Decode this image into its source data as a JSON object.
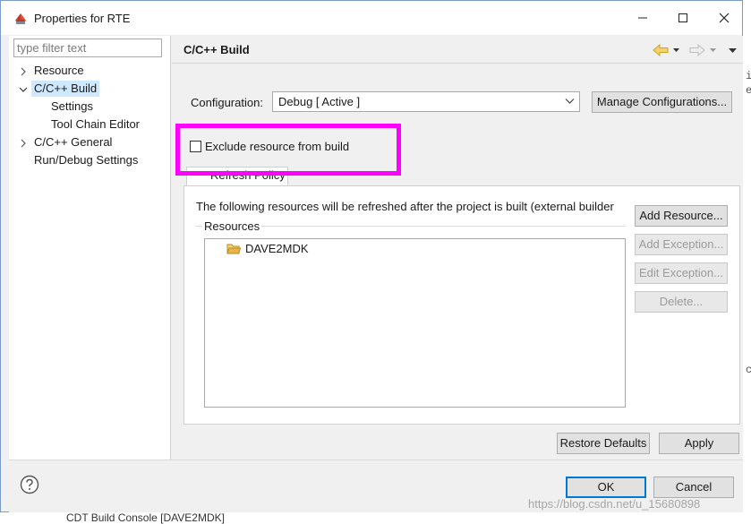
{
  "window": {
    "title": "Properties for RTE",
    "controls": {
      "minimize": "minimize-icon",
      "maximize": "maximize-icon",
      "close": "close-icon"
    }
  },
  "sidebar": {
    "filter_placeholder": "type filter text",
    "items": [
      {
        "label": "Resource",
        "twisty": "collapsed"
      },
      {
        "label": "C/C++ Build",
        "twisty": "expanded",
        "selected": true
      },
      {
        "label": "Settings"
      },
      {
        "label": "Tool Chain Editor"
      },
      {
        "label": "C/C++ General",
        "twisty": "collapsed"
      },
      {
        "label": "Run/Debug Settings"
      }
    ]
  },
  "page": {
    "title": "C/C++ Build",
    "configuration_label": "Configuration:",
    "configuration_value": "Debug  [ Active ]",
    "manage_button": "Manage Configurations...",
    "exclude_label": "Exclude resource from build",
    "exclude_checked": false,
    "tab_label": "Refresh Policy",
    "description": "The following resources will be refreshed after the project is built (external builder",
    "resources_label": "Resources",
    "resources": [
      "DAVE2MDK"
    ],
    "buttons": {
      "add_resource": "Add Resource...",
      "add_exception": "Add Exception...",
      "edit_exception": "Edit Exception...",
      "delete": "Delete..."
    },
    "restore_defaults": "Restore Defaults",
    "apply": "Apply"
  },
  "footer": {
    "ok": "OK",
    "cancel": "Cancel"
  },
  "background": {
    "console_tab": "CDT Build Console [DAVE2MDK]",
    "watermark": "https://blog.csdn.net/u_15680898",
    "edge_chars": [
      "i",
      "e",
      "c"
    ]
  },
  "colors": {
    "highlight": "#ff00ff",
    "selection": "#cde8ff",
    "primary_border": "#0078d7",
    "folder": "#e8b64a"
  }
}
